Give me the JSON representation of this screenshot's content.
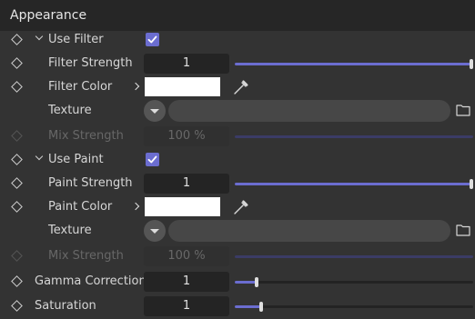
{
  "header": {
    "title": "Appearance"
  },
  "filter": {
    "use_label": "Use Filter",
    "use_checked": true,
    "strength_label": "Filter Strength",
    "strength_value": "1",
    "strength_fraction": 1.0,
    "color_label": "Filter Color",
    "color_value": "#ffffff",
    "texture_label": "Texture",
    "mix_label": "Mix Strength",
    "mix_value": "100 %",
    "mix_fraction": 1.0
  },
  "paint": {
    "use_label": "Use Paint",
    "use_checked": true,
    "strength_label": "Paint Strength",
    "strength_value": "1",
    "strength_fraction": 1.0,
    "color_label": "Paint Color",
    "color_value": "#ffffff",
    "texture_label": "Texture",
    "mix_label": "Mix Strength",
    "mix_value": "100 %",
    "mix_fraction": 1.0
  },
  "gamma": {
    "label": "Gamma Correction",
    "value": "1",
    "fraction": 0.09
  },
  "saturation": {
    "label": "Saturation",
    "value": "1",
    "fraction": 0.11
  },
  "colors": {
    "accent": "#6b6dd0",
    "panel": "#333333",
    "header": "#262626",
    "field": "#242424"
  }
}
